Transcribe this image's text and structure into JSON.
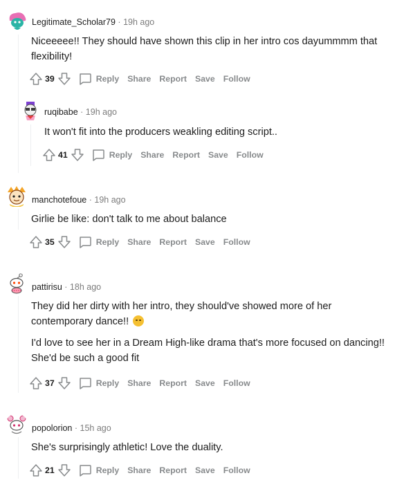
{
  "actions": {
    "reply": "Reply",
    "share": "Share",
    "report": "Report",
    "save": "Save",
    "follow": "Follow"
  },
  "separator": "·",
  "comments": [
    {
      "author": "Legitimate_Scholar79",
      "time": "19h ago",
      "body": [
        "Niceeeee!! They should have shown this clip in her intro cos dayummmm that flexibility!"
      ],
      "score": "39",
      "avatar_colors": [
        "#2bb4a6",
        "#e86fb4"
      ]
    },
    {
      "author": "ruqibabe",
      "time": "19h ago",
      "body": [
        "It won't fit into the producers weakling editing script.."
      ],
      "score": "41",
      "avatar_colors": [
        "#7c3fd1",
        "#f7a1c4"
      ]
    },
    {
      "author": "manchotefoue",
      "time": "19h ago",
      "body": [
        "Girlie be like: don't talk to me about balance"
      ],
      "score": "35",
      "avatar_colors": [
        "#f4a52a",
        "#8b4513"
      ]
    },
    {
      "author": "pattirisu",
      "time": "18h ago",
      "body": [
        "They did her dirty with her intro, they should've showed more of her contemporary dance!!",
        "I'd love to see her in a Dream High-like drama that's more focused on dancing!! She'd be such a good fit"
      ],
      "score": "37",
      "avatar_colors": [
        "#ffffff",
        "#ff4500"
      ]
    },
    {
      "author": "popolorion",
      "time": "15h ago",
      "body": [
        "She's surprisingly athletic! Love the duality."
      ],
      "score": "21",
      "avatar_colors": [
        "#f2b8d0",
        "#d12e6b"
      ]
    }
  ]
}
